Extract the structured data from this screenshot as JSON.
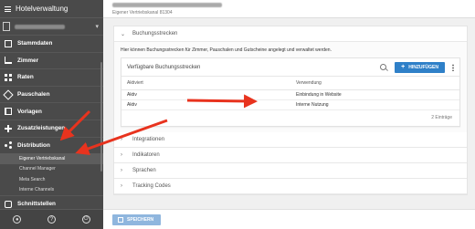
{
  "sidebar": {
    "title": "Hotelverwaltung",
    "items": [
      {
        "label": "Stammdaten",
        "icon": "building-icon"
      },
      {
        "label": "Zimmer",
        "icon": "bed-icon"
      },
      {
        "label": "Raten",
        "icon": "grid-icon"
      },
      {
        "label": "Pauschalen",
        "icon": "tag-icon"
      },
      {
        "label": "Vorlagen",
        "icon": "book-icon"
      },
      {
        "label": "Zusatzleistungen",
        "icon": "plus-icon"
      },
      {
        "label": "Distribution",
        "icon": "share-icon"
      }
    ],
    "distribution_sub": [
      {
        "label": "Eigener Vertriebskanal"
      },
      {
        "label": "Channel Manager"
      },
      {
        "label": "Meta Search"
      },
      {
        "label": "Interne Channels"
      }
    ],
    "last_item": {
      "label": "Schnittstellen",
      "icon": "api-icon"
    },
    "footer_icons": [
      "user-icon",
      "help-icon",
      "power-icon"
    ],
    "footer_help_glyph": "?"
  },
  "topbar": {
    "subtitle": "Eigener Vertriebskanal 81304"
  },
  "main": {
    "sections": [
      {
        "label": "Buchungsstrecken",
        "expanded": true
      },
      {
        "label": "Integrationen"
      },
      {
        "label": "Indikatoren"
      },
      {
        "label": "Sprachen"
      },
      {
        "label": "Tracking Codes"
      }
    ],
    "description": "Hier können Buchungsstrecken für Zimmer, Pauschalen und Gutscheine angelegt und verwaltet werden.",
    "card": {
      "title": "Verfügbare Buchungsstrecken",
      "add_label": "HINZUFÜGEN",
      "columns": [
        "Aktiviert",
        "Verwendung"
      ],
      "rows": [
        [
          "Aktiv",
          "Einbindung in Website"
        ],
        [
          "Aktiv",
          "Interne Nutzung"
        ]
      ],
      "count": "2 Einträge"
    }
  },
  "savebar": {
    "label": "SPEICHERN"
  },
  "colors": {
    "accent": "#2f80c8",
    "sidebar": "#4a4a4a",
    "arrow": "#e8331e"
  }
}
